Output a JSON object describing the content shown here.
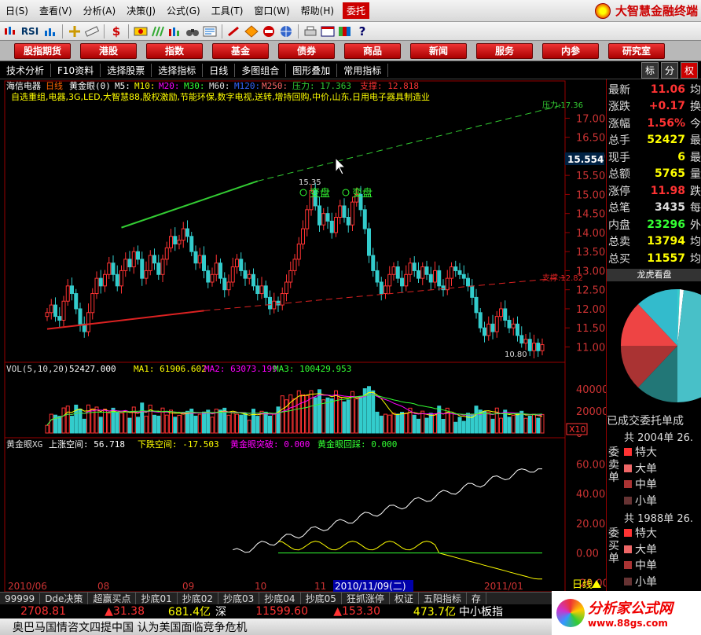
{
  "menubar": {
    "items": [
      "日(S)",
      "查看(V)",
      "分析(A)",
      "决策(J)",
      "公式(G)",
      "工具(T)",
      "窗口(W)",
      "帮助(H)"
    ],
    "active": "委托",
    "brand": "大智慧金融终端"
  },
  "toolbar": {
    "items": [
      "rsi-label",
      "K-line-icon",
      "cross-icon",
      "ruler-icon",
      "dollar-icon",
      "bars-icon",
      "compare-icon",
      "binoculars-icon",
      "f10-icon",
      "diamond-icon",
      "no-entry-icon",
      "globe-icon",
      "question-icon"
    ],
    "rsi_label": "RSI"
  },
  "navbar": {
    "items": [
      "股指期货",
      "港股",
      "指数",
      "基金",
      "债券",
      "商品",
      "新闻",
      "服务",
      "内参",
      "研究室"
    ]
  },
  "subtoolbar": {
    "items": [
      "技术分析",
      "F10资料",
      "选择股票",
      "选择指标",
      "日线",
      "多图组合",
      "图形叠加",
      "常用指标"
    ],
    "right_tabs": [
      "标",
      "分",
      "权"
    ]
  },
  "chart_header": {
    "stock": "海信电器",
    "period": "日线",
    "indicator": "黄金眼(0)",
    "ma5": "M5:",
    "ma10": "M10:",
    "ma20": "M20:",
    "ma30": "M30:",
    "ma60": "M60:",
    "ma120": "M120:",
    "ma250": "M250:",
    "pressure_label": "压力: 17.363",
    "support_label": "支撑: 12.818",
    "concepts": "自选重组,电器,3G,LED,大智慧88,股权激励,节能环保,数字电视,送转,增持回购,中价,山东,日用电子器具制造业"
  },
  "chart_data": [
    {
      "type": "candlestick",
      "title": "海信电器 日线",
      "y_ticks": [
        17.0,
        16.5,
        16.0,
        15.5,
        15.0,
        14.5,
        14.0,
        13.5,
        13.0,
        12.5,
        12.0,
        11.5,
        11.0
      ],
      "ylim": [
        10.7,
        17.4
      ],
      "x_ticks": [
        "2010/06",
        "08",
        "09",
        "10",
        "11",
        "2010/11/09(二)",
        "2011/01"
      ],
      "close": [
        11.9,
        12.1,
        11.8,
        11.7,
        12.2,
        12.6,
        12.4,
        12.0,
        11.6,
        11.4,
        11.9,
        12.4,
        12.8,
        12.6,
        12.9,
        13.2,
        12.9,
        12.6,
        13.0,
        13.3,
        13.1,
        13.5,
        13.3,
        12.8,
        13.0,
        13.4,
        13.2,
        12.9,
        13.3,
        13.6,
        13.9,
        13.7,
        13.8,
        14.1,
        13.9,
        13.5,
        13.2,
        13.4,
        13.0,
        12.7,
        12.9,
        13.2,
        12.8,
        12.5,
        12.7,
        13.1,
        13.3,
        13.0,
        12.8,
        12.9,
        12.6,
        12.4,
        12.6,
        12.3,
        12.0,
        12.2,
        12.1,
        12.4,
        12.7,
        13.0,
        13.3,
        13.7,
        14.1,
        14.6,
        15.1,
        14.7,
        14.2,
        14.5,
        14.3,
        14.0,
        14.4,
        14.7,
        14.4,
        14.2,
        14.8,
        15.0,
        14.6,
        14.1,
        13.4,
        13.0,
        12.7,
        12.4,
        12.6,
        12.9,
        13.1,
        12.8,
        12.6,
        12.9,
        13.2,
        13.0,
        12.8,
        13.1,
        12.9,
        12.7,
        13.0,
        12.6,
        12.5,
        12.8,
        13.1,
        13.0,
        12.9,
        12.8,
        12.6,
        12.3,
        11.9,
        11.5,
        11.3,
        11.6,
        11.4,
        11.8,
        12.0,
        11.7,
        11.5,
        11.6,
        11.3,
        11.1,
        11.2,
        10.9,
        11.1,
        10.9,
        11.06
      ],
      "pressure_line": {
        "label": "压力:17.36",
        "start": 14.13,
        "end": 17.36
      },
      "support_line": {
        "label": "支撑:12.82",
        "start": 11.47,
        "end": 12.82
      },
      "annotations": [
        {
          "text": "变盘"
        },
        {
          "text": "变盘"
        },
        {
          "text": "15.35"
        },
        {
          "text": "10.80"
        }
      ],
      "current_price": "15.554"
    },
    {
      "type": "bar",
      "title": "VOL",
      "label": "VOL(5,10,20)",
      "value": "52427.000",
      "ma1": "MA1: 61906.602",
      "ma2": "MA2: 63073.199",
      "ma3": "MA3: 100429.953",
      "y_ticks": [
        40000,
        20000,
        0
      ],
      "ylim": [
        0,
        50000
      ],
      "unit_badge": "X10"
    },
    {
      "type": "line",
      "title": "黄金眼XG",
      "label": "黄金眼XG",
      "up_space": "上涨空间: 56.718",
      "down_space": "下跌空间: -17.503",
      "breakthrough": "黄金眼突破: 0.000",
      "pullback": "黄金眼回踩: 0.000",
      "y_ticks": [
        60.0,
        40.0,
        20.0,
        0.0,
        -20.0
      ],
      "ylim": [
        -24,
        66
      ]
    }
  ],
  "right_panel": {
    "quotes": [
      {
        "label": "最新",
        "value": "11.06",
        "color": "#f33",
        "tail": "均"
      },
      {
        "label": "涨跌",
        "value": "+0.17",
        "color": "#f33",
        "tail": "换"
      },
      {
        "label": "涨幅",
        "value": "1.56%",
        "color": "#f33",
        "tail": "今"
      },
      {
        "label": "总手",
        "value": "52427",
        "color": "#ff0",
        "tail": "最"
      },
      {
        "label": "现手",
        "value": "6",
        "color": "#ff0",
        "tail": "最"
      },
      {
        "label": "总额",
        "value": "5765",
        "color": "#ff0",
        "tail": "量"
      },
      {
        "label": "涨停",
        "value": "11.98",
        "color": "#f33",
        "tail": "跌"
      },
      {
        "label": "总笔",
        "value": "3435",
        "color": "#ddd",
        "tail": "每"
      },
      {
        "label": "内盘",
        "value": "23296",
        "color": "#3f3",
        "tail": "外"
      },
      {
        "label": "总卖",
        "value": "13794",
        "color": "#ff0",
        "tail": "均"
      },
      {
        "label": "总买",
        "value": "11557",
        "color": "#ff0",
        "tail": "均"
      }
    ],
    "pie_title": "龙虎看盘",
    "pie_caption": "已成交委托单成",
    "buy_orders": {
      "label": "委买单",
      "total": "共 1988单 26.",
      "rows": [
        "特大",
        "大单",
        "中单",
        "小单"
      ]
    },
    "sell_orders": {
      "label": "委卖单",
      "total": "共 2004单 26.",
      "rows": [
        "特大",
        "大单",
        "中单",
        "小单"
      ]
    },
    "period_label": "日线"
  },
  "bottom_tabs": [
    "99999",
    "Dde决策",
    "超赢买点",
    "抄底01",
    "抄底02",
    "抄底03",
    "抄底04",
    "抄底05",
    "狂抓涨停",
    "权证",
    "五阳指标",
    "存"
  ],
  "indexbar": {
    "v1": "2708.81",
    "c1": "▲31.38",
    "a1": "681.4亿",
    "m2": "深",
    "v2": "11599.60",
    "c2": "▲153.30",
    "a2": "473.7亿",
    "m3": "中小板指"
  },
  "news": "奥巴马国情咨文四提中国 认为美国面临竞争危机",
  "watermark": {
    "title": "分析家公式网",
    "url": "www.88gs.com"
  },
  "colors": {
    "up": "#f33",
    "down": "#3cc",
    "pressure": "#3c3",
    "support": "#d22",
    "frame": "#900"
  }
}
